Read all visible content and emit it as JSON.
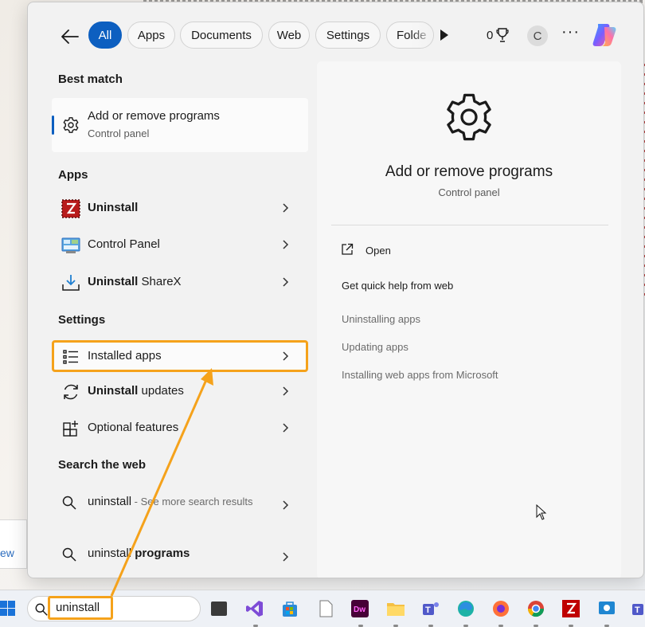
{
  "filters": {
    "back_label": "←",
    "tabs": [
      {
        "label": "All",
        "active": true
      },
      {
        "label": "Apps"
      },
      {
        "label": "Documents"
      },
      {
        "label": "Web"
      },
      {
        "label": "Settings"
      },
      {
        "label": "Folde"
      }
    ],
    "points": "0",
    "avatar_letter": "C",
    "more_label": "···"
  },
  "left": {
    "best_match_heading": "Best match",
    "best_match": {
      "title": "Add or remove programs",
      "subtitle": "Control panel"
    },
    "apps_heading": "Apps",
    "apps": [
      {
        "bold": "Uninstall",
        "rest": ""
      },
      {
        "bold": "",
        "rest": "Control Panel"
      },
      {
        "bold": "Uninstall",
        "rest": " ShareX"
      }
    ],
    "settings_heading": "Settings",
    "settings": [
      {
        "bold": "",
        "rest": "Installed apps"
      },
      {
        "bold": "Uninstall",
        "rest": " updates"
      },
      {
        "bold": "",
        "rest": "Optional features"
      }
    ],
    "web_heading": "Search the web",
    "web": [
      {
        "query": "uninstall",
        "suffix": " - See more search results"
      },
      {
        "query": "uninstall",
        "bold": " programs"
      }
    ]
  },
  "right": {
    "title": "Add or remove programs",
    "subtitle": "Control panel",
    "open_label": "Open",
    "quick_help_heading": "Get quick help from web",
    "quick_links": [
      "Uninstalling apps",
      "Updating apps",
      "Installing web apps from Microsoft"
    ]
  },
  "taskbar": {
    "search_text": "uninstall",
    "apps": [
      "desktop-app",
      "visual-studio",
      "store",
      "notepad",
      "dreamweaver",
      "file-explorer",
      "teams",
      "edge",
      "firefox",
      "chrome",
      "filezilla",
      "remote-app",
      "teams-2"
    ]
  },
  "background": {
    "left_link_fragment": "ew"
  },
  "colors": {
    "accent": "#0d5fc0",
    "highlight": "#f5a21b"
  }
}
